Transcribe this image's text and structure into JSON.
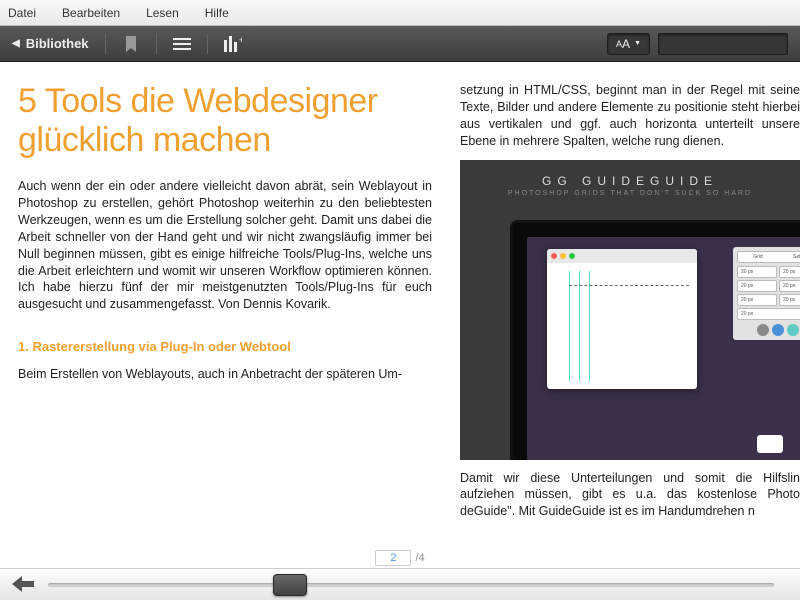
{
  "menu": {
    "file": "Datei",
    "edit": "Bearbeiten",
    "read": "Lesen",
    "help": "Hilfe"
  },
  "toolbar": {
    "library": "Bibliothek",
    "fontBtn": "A",
    "fontBtnSub": "A"
  },
  "page": {
    "current": "2",
    "sep": " / ",
    "total": "4"
  },
  "article": {
    "title": "5 Tools die Webdesig­ner glücklich ma­chen",
    "lead": "Auch wenn der ein oder andere vielleicht davon abrät, sein Weblayout in Photoshop zu erstellen, gehört Photoshop weiterhin zu den belieb­testen Werkzeugen, wenn es um die Erstellung solcher geht. Damit uns dabei die Arbeit schneller von der Hand geht und wir nicht zwangsläu­fig immer bei Null beginnen müssen, gibt es einige hilfreiche Tools/Plug-Ins, welche uns die Arbeit erleichtern und womit wir unseren Work­flow optimieren können. Ich habe hierzu fünf der mir meistgenutz­ten Tools/Plug-Ins für euch ausgesucht und zusammengefasst. Von Dennis Kovarik.",
    "h2": "1. Rastererstellung via Plug-In oder Webtool",
    "p2": "Beim Erstellen von Weblayouts, auch in Anbetracht der späteren Um-",
    "col2a": "setzung in HTML/CSS, beginnt man in der Regel mit seine Texte, Bilder und andere Elemente zu positionie steht hierbei aus vertikalen und ggf. auch horizonta unterteilt unsere Ebene in mehrere Spalten, welche rung dienen.",
    "col2b": "Damit wir diese Unterteilungen und somit die Hilfslin aufziehen müssen, gibt es u.a. das kostenlose Photo deGuide\". Mit GuideGuide ist es im Handumdrehen n"
  },
  "guide": {
    "brand": "GG  GUIDEGUIDE",
    "tagline": "PHOTOSHOP GRIDS THAT DON'T SUCK SO HARD",
    "tab1": "Grid",
    "tab2": "Sets",
    "val": "20 px"
  }
}
